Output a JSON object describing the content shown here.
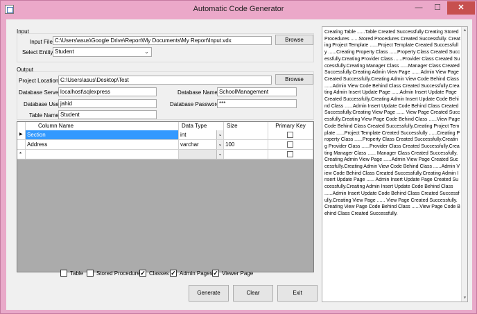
{
  "window": {
    "title": "Automatic Code Generator"
  },
  "input_group": {
    "title": "Input",
    "input_file_label": "Input File",
    "input_file_value": "C:\\Users\\asus\\Google Drive\\Report\\My Documents\\My Report\\Input.vdx",
    "browse_label": "Browse",
    "select_entity_label": "Select Entity",
    "select_entity_value": "Student"
  },
  "output_group": {
    "title": "Output",
    "project_location_label": "Project Location",
    "project_location_value": "C:\\Users\\asus\\Desktop\\Test",
    "browse_label": "Browse",
    "db_server_label": "Database Server",
    "db_server_value": "localhost\\sqlexpress",
    "db_name_label": "Database Name",
    "db_name_value": "SchoolManagement",
    "db_user_label": "Database User",
    "db_user_value": "jahid",
    "db_password_label": "Database Password",
    "db_password_value": "***",
    "table_name_label": "Table Name",
    "table_name_value": "Student"
  },
  "grid": {
    "columns": [
      "Column Name",
      "Data Type",
      "Size",
      "Primary Key"
    ],
    "rows": [
      {
        "column_name": "Section",
        "data_type": "int",
        "size": "",
        "primary_key": false
      },
      {
        "column_name": "Address",
        "data_type": "varchar",
        "size": "100",
        "primary_key": false
      }
    ],
    "new_row_marker": "*",
    "current_row_marker": "▶"
  },
  "options": [
    {
      "label": "Table",
      "checked": false
    },
    {
      "label": "Stored Procedures",
      "checked": false
    },
    {
      "label": "Classes",
      "checked": true
    },
    {
      "label": "Admin Pages",
      "checked": true
    },
    {
      "label": "Viewer Page",
      "checked": true
    }
  ],
  "buttons": {
    "generate": "Generate",
    "clear": "Clear",
    "exit": "Exit"
  },
  "log": {
    "text": "Creating Table ......Table Created Successfully.Creating Stored Procedures ......Stored Procedures Created Successfully. Creating Project Template ......Project Template Created Successfully ......Creating Property Class ......Property Class Created Successfully.Creating Provider Class ......Provider Class Created Successfully.Creating Manager Class ......Manager Class Created Successfully.Creating Admin View Page ...... Admin View Page Created Successfully.Creating Admin View Code Behind Class ......Admin View Code Behind Class Created Successfully.Creating Admin Insert Update Page ......Admin Insert Update Page Created Successfully.Creating Admin Insert Update Code Behind Class ......Admin Insert Update Code Behind Class Created Successfully.Creating View Page ...... View Page Created Successfully.Creating View Page Code Behind Class ......View Page Code Behind Class Created Successfully.Creating Project Template ......Project Template Created Successfully ......Creating Property Class ......Property Class Created Successfully.Creating Provider Class ......Provider Class Created Successfully.Creating Manager Class ...... Manager Class Created Successfully.Creating Admin View Page ......Admin View Page Created Successfully.Creating Admin View Code Behind Class ......Admin View Code Behind Class Created Successfully.Creating Admin Insert Update Page ...... Admin Insert Update Page Created Successfully.Creating Admin Insert Update Code Behind Class ......Admin Insert Update Code Behind Class Created Successfully.Creating View Page ...... View Page Created Successfully.Creating View Page Code Behind Class ......View Page Code Behind Class Created Successfully."
  },
  "window_controls": {
    "minimize": "—",
    "maximize": "☐",
    "close": "✕"
  }
}
